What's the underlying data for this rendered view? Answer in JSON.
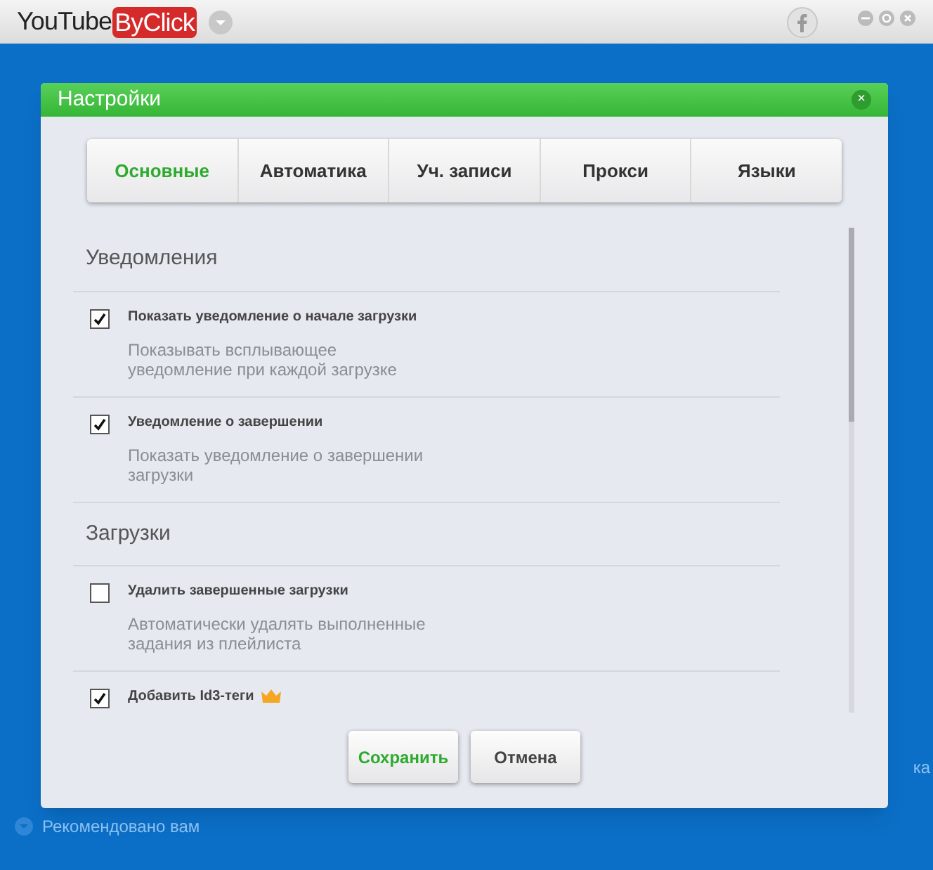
{
  "app": {
    "logo_left": "YouTube",
    "logo_right": "ByClick"
  },
  "background": {
    "recommended": "Рекомендовано вам",
    "side_text": "ка"
  },
  "dialog": {
    "title": "Настройки",
    "close": "×",
    "tabs": [
      {
        "label": "Основные",
        "selected": true
      },
      {
        "label": "Автоматика",
        "selected": false
      },
      {
        "label": "Уч. записи",
        "selected": false
      },
      {
        "label": "Прокси",
        "selected": false
      },
      {
        "label": "Языки",
        "selected": false
      }
    ],
    "sections": [
      {
        "heading": "Уведомления",
        "options": [
          {
            "label": "Показать уведомление о начале загрузки",
            "description": "Показывать всплывающее уведомление при каждой загрузке",
            "checked": true,
            "premium": false
          },
          {
            "label": "Уведомление о завершении",
            "description": "Показать уведомление о завершении загрузки",
            "checked": true,
            "premium": false
          }
        ]
      },
      {
        "heading": "Загрузки",
        "options": [
          {
            "label": "Удалить завершенные загрузки",
            "description": "Автоматически удалять выполненные задания из плейлиста",
            "checked": false,
            "premium": false
          },
          {
            "label": "Добавить Id3-теги",
            "checked": true,
            "premium": true
          }
        ]
      }
    ],
    "buttons": [
      {
        "label": "Сохранить",
        "kind": "primary"
      },
      {
        "label": "Отмена",
        "kind": "secondary"
      }
    ]
  }
}
